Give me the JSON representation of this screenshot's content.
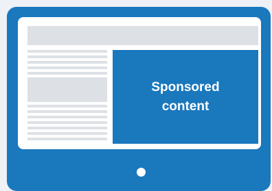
{
  "ad_panel": {
    "label": "Sponsored\ncontent"
  },
  "colors": {
    "monitor_blue": "#1a78bd",
    "screen_white": "#ffffff",
    "placeholder_gray": "#dde1e6"
  },
  "icons": {
    "home_button": "home-button-icon"
  }
}
